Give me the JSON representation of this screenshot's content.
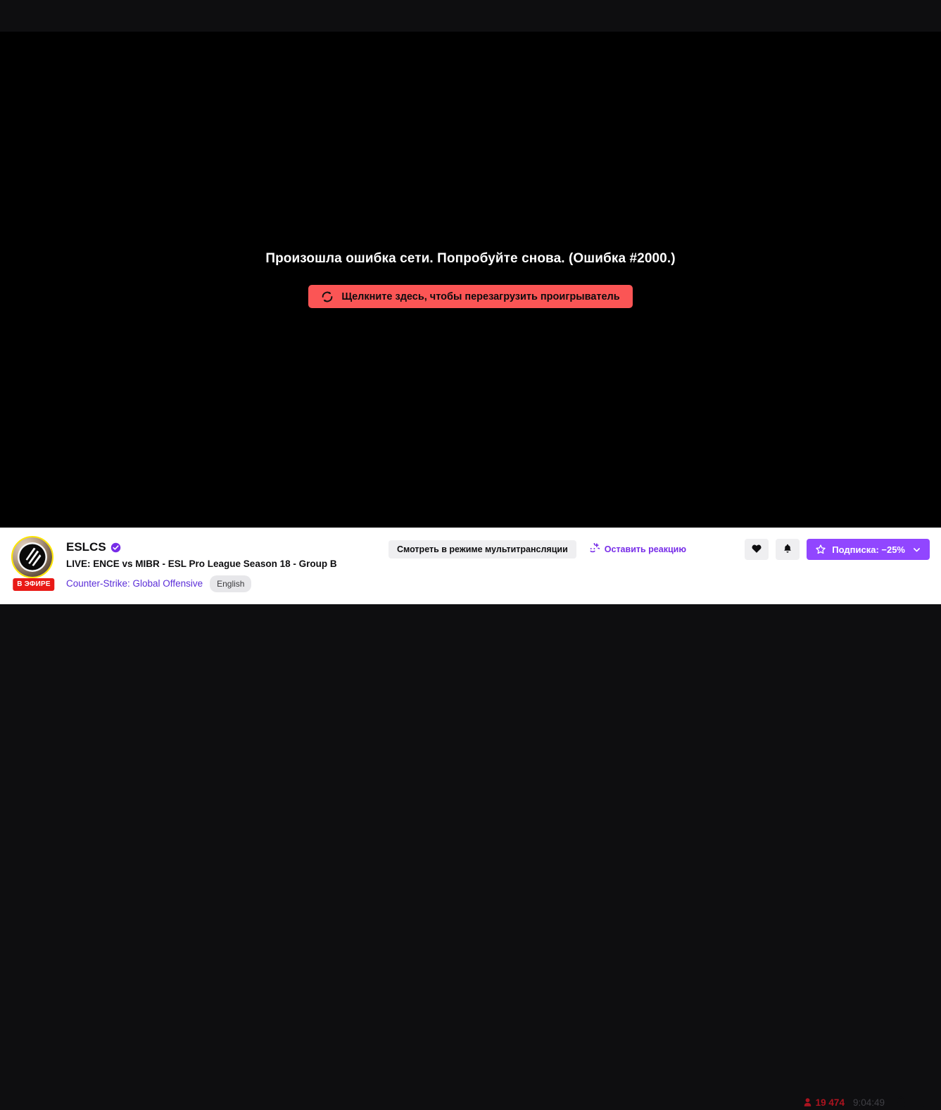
{
  "player": {
    "error_title": "Произошла ошибка сети. Попробуйте снова. (Ошибка #2000.)",
    "reload_label": "Щелкните здесь, чтобы перезагрузить проигрыватель",
    "reload_icon": "refresh-icon",
    "background_color": "#000000",
    "error_button_color": "#fb5555"
  },
  "channel": {
    "name": "ESLCS",
    "verified_icon": "verified-badge-icon",
    "live_badge": "В ЭФИРЕ",
    "stream_title": "LIVE: ENCE vs MIBR - ESL Pro League Season 18 - Group B",
    "category": "Counter-Strike: Global Offensive",
    "tags": [
      "English"
    ],
    "avatar_icon": "esl-logo-avatar",
    "avatar_ring_color": "#ffe600",
    "live_badge_color": "#e91916",
    "category_link_color": "#5b2dd8"
  },
  "actions": {
    "multistream_label": "Смотреть в режиме мультитрансляции",
    "reaction_label": "Оставить реакцию",
    "reaction_icon": "smiley-plus-icon",
    "follow_icon": "heart-icon",
    "notify_icon": "bell-icon",
    "subscribe_label": "Подписка: −25%",
    "subscribe_star_icon": "star-icon",
    "subscribe_chevron_icon": "chevron-down-icon",
    "subscribe_color": "#9146ff"
  },
  "stats": {
    "viewer_icon": "person-icon",
    "viewer_count": "19 474",
    "uptime": "9:04:49",
    "share_icon": "share-icon",
    "more_icon": "kebab-menu-icon",
    "viewer_color": "#ab131f"
  }
}
